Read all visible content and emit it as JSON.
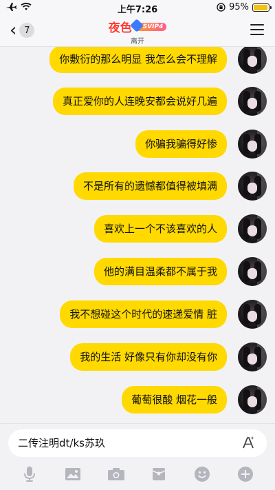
{
  "status_bar": {
    "time": "上午7:26",
    "battery_percent": "95%",
    "battery_level": 0.95
  },
  "nav": {
    "back_count": "7",
    "contact_name": "夜色",
    "svip_label": "SVIP4",
    "contact_status": "离开"
  },
  "messages": [
    {
      "text": "你敷衍的那么明显 我怎么会不理解"
    },
    {
      "text": "真正爱你的人连晚安都会说好几遍"
    },
    {
      "text": "你骗我骗得好惨"
    },
    {
      "text": "不是所有的遗憾都值得被填满"
    },
    {
      "text": "喜欢上一个不该喜欢的人"
    },
    {
      "text": "他的满目温柔都不属于我"
    },
    {
      "text": "我不想碰这个时代的速递爱情 脏"
    },
    {
      "text": "我的生活 好像只有你却没有你"
    },
    {
      "text": "葡萄很酸 烟花一般"
    }
  ],
  "input": {
    "value": "二传注明dt/ks苏玖"
  },
  "toolbar": {
    "icons": [
      "microphone-icon",
      "image-icon",
      "camera-icon",
      "red-packet-icon",
      "emoji-icon",
      "plus-icon"
    ]
  },
  "colors": {
    "bubble": "#ffd900",
    "title": "#ff3b30",
    "icon": "#b5b5bd"
  }
}
